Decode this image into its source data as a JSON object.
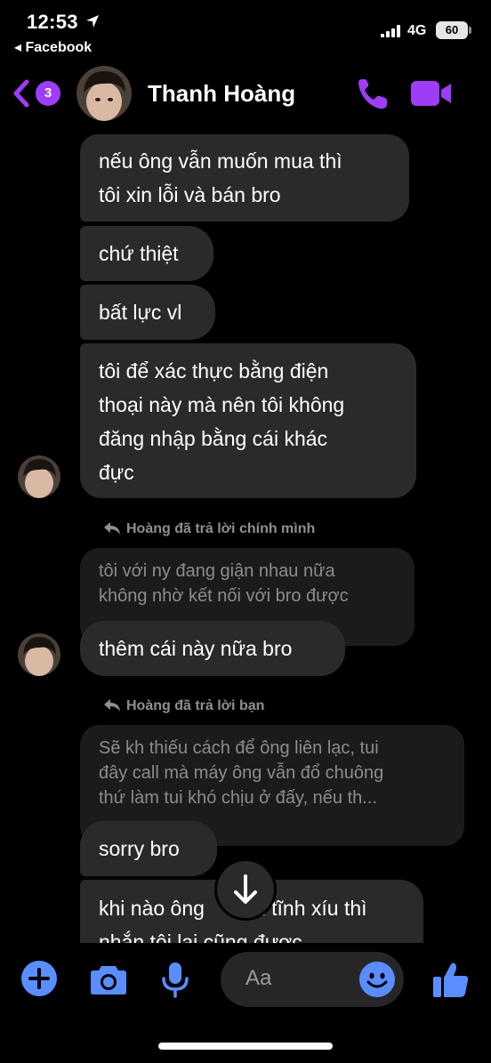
{
  "status_bar": {
    "time": "12:53",
    "back_app": "◂ Facebook",
    "network": "4G",
    "battery": "60"
  },
  "header": {
    "unread_count": "3",
    "contact_name": "Thanh Hoàng",
    "icons": [
      "back-chevron-icon",
      "phone-icon",
      "video-camera-icon"
    ]
  },
  "messages": {
    "m1": [
      "nếu ông vẫn muốn mua thì",
      "tôi xin lỗi và bán bro"
    ],
    "m2": "chứ thiệt",
    "m3": "bất lực vl",
    "m4": [
      "tôi để xác thực bằng điện",
      "thoại này mà nên tôi không",
      "đăng nhập bằng cái khác",
      "đực"
    ],
    "reply1_label": "Hoàng đã trả lời chính mình",
    "reply1_quote": [
      "tôi với ny đang giận nhau nữa",
      "không nhờ kết nối với bro được"
    ],
    "m5": "thêm cái này nữa bro",
    "reply2_label": "Hoàng đã trả lời bạn",
    "reply2_quote": [
      "Sẽ kh thiếu cách để ông liên lạc, tui",
      "đây call mà máy ông vẫn đổ chuông",
      "thứ làm tui khó chịu ở đấy, nếu th..."
    ],
    "m6": "sorry bro",
    "m7": [
      "khi nào ông",
      "n tĩnh xíu thì",
      "nhắn tôi lại cũng được"
    ]
  },
  "composer": {
    "placeholder": "Aa",
    "icons": [
      "plus-icon",
      "camera-icon",
      "microphone-icon",
      "emoji-icon",
      "thumbs-up-icon"
    ]
  },
  "colors": {
    "accent_purple": "#9e3cf7",
    "accent_blue": "#5a8dff",
    "bubble": "#2a2a2c",
    "background": "#000000"
  }
}
